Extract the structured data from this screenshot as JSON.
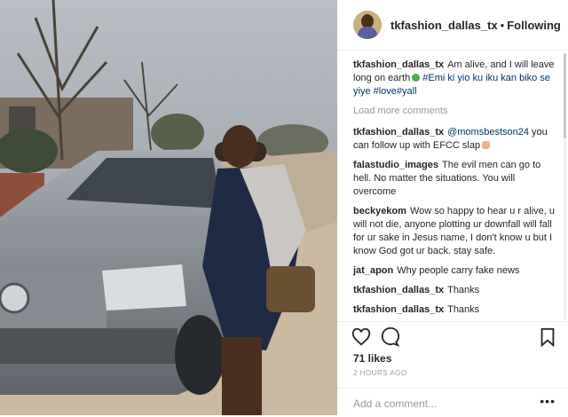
{
  "header": {
    "username": "tkfashion_dallas_tx",
    "separator": "•",
    "follow_status": "Following"
  },
  "caption": {
    "username": "tkfashion_dallas_tx",
    "text_before": "Am alive, and I will leave long on earth",
    "text_after": "#Emi ki yio ku iku kan biko se yiye #love#yall"
  },
  "load_more": "Load more comments",
  "comments": [
    {
      "username": "tkfashion_dallas_tx",
      "mention": "@momsbestson24",
      "text": "you can follow up with EFCC slap"
    },
    {
      "username": "falastudio_images",
      "text": "The evil men can go to hell. No matter the situations. You will overcome"
    },
    {
      "username": "beckyekom",
      "text": "Wow so happy to hear u r alive, u will not die, anyone plotting ur downfall will fall for ur sake in Jesus name, I don't know u but I know God got ur back. stay safe."
    },
    {
      "username": "jat_apon",
      "text": "Why people carry fake news"
    },
    {
      "username": "tkfashion_dallas_tx",
      "text": "Thanks"
    },
    {
      "username": "tkfashion_dallas_tx",
      "text": "Thanks"
    }
  ],
  "post": {
    "likes": "71 likes",
    "time": "2 HOURS AGO"
  },
  "add_comment": {
    "placeholder": "Add a comment...",
    "more": "•••"
  },
  "icons": {
    "like": "heart-icon",
    "comment": "comment-icon",
    "save": "bookmark-icon"
  }
}
